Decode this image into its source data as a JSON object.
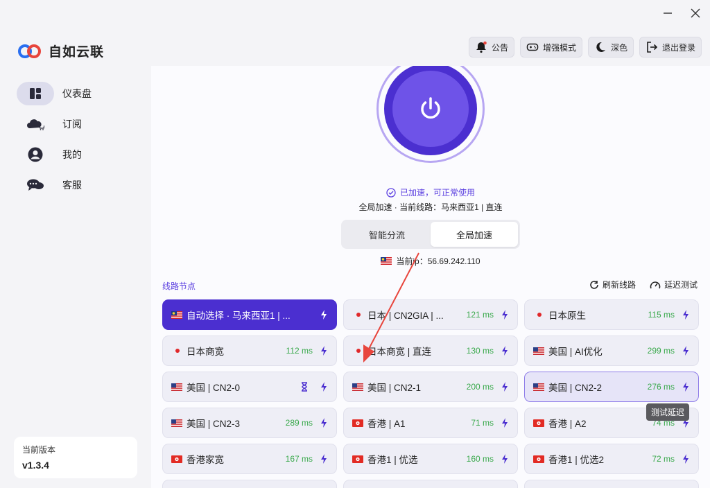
{
  "window": {
    "minimize_icon": "minus-icon",
    "close_icon": "x-icon"
  },
  "brand": {
    "name": "自如云联"
  },
  "sidebar": {
    "items": [
      {
        "label": "仪表盘",
        "icon": "dashboard-icon",
        "active": true
      },
      {
        "label": "订阅",
        "icon": "cloud-cart-icon",
        "active": false
      },
      {
        "label": "我的",
        "icon": "user-icon",
        "active": false
      },
      {
        "label": "客服",
        "icon": "chat-icon",
        "active": false
      }
    ],
    "version_label": "当前版本",
    "version_value": "v1.3.4"
  },
  "header": {
    "buttons": [
      {
        "label": "公告",
        "icon": "bell-icon"
      },
      {
        "label": "增强模式",
        "icon": "gamepad-icon"
      },
      {
        "label": "深色",
        "icon": "moon-icon"
      },
      {
        "label": "退出登录",
        "icon": "logout-icon"
      }
    ]
  },
  "connection": {
    "status": "已加速，可正常使用",
    "route": "全局加速 · 当前线路：马来西亚1 | 直连",
    "modes": [
      "智能分流",
      "全局加速"
    ],
    "active_mode": "全局加速",
    "ip_label": "当前ip：56.69.242.110"
  },
  "nodes_section": {
    "title": "线路节点",
    "refresh": "刷新线路",
    "test": "延迟测试",
    "tooltip": "测试延迟"
  },
  "nodes": [
    {
      "name": "自动选择 · 马来西亚1 | ...",
      "flag": "my",
      "latency": "",
      "selected": true
    },
    {
      "name": "日本 | CN2GIA | ...",
      "flag": "jp",
      "latency": "121 ms"
    },
    {
      "name": "日本原生",
      "flag": "jp",
      "latency": "115 ms"
    },
    {
      "name": "日本商宽",
      "flag": "jp",
      "latency": "112 ms"
    },
    {
      "name": "日本商宽 | 直连",
      "flag": "jp",
      "latency": "130 ms"
    },
    {
      "name": "美国 | AI优化",
      "flag": "us",
      "latency": "299 ms"
    },
    {
      "name": "美国 | CN2-0",
      "flag": "us",
      "latency": "",
      "testing": true
    },
    {
      "name": "美国 | CN2-1",
      "flag": "us",
      "latency": "200 ms"
    },
    {
      "name": "美国 | CN2-2",
      "flag": "us",
      "latency": "276 ms",
      "hover": true
    },
    {
      "name": "美国 | CN2-3",
      "flag": "us",
      "latency": "289 ms"
    },
    {
      "name": "香港 | A1",
      "flag": "hk",
      "latency": "71 ms"
    },
    {
      "name": "香港 | A2",
      "flag": "hk",
      "latency": "74 ms"
    },
    {
      "name": "香港家宽",
      "flag": "hk",
      "latency": "167 ms"
    },
    {
      "name": "香港1 | 优选",
      "flag": "hk",
      "latency": "160 ms"
    },
    {
      "name": "香港1 | 优选2",
      "flag": "hk",
      "latency": "72 ms"
    },
    {
      "name": "",
      "flag": "",
      "latency": ""
    },
    {
      "name": "",
      "flag": "",
      "latency": ""
    },
    {
      "name": "",
      "flag": "",
      "latency": ""
    }
  ],
  "colors": {
    "accent": "#4b2fd0",
    "latency": "#3aa94c",
    "annotation": "#e8453c"
  }
}
